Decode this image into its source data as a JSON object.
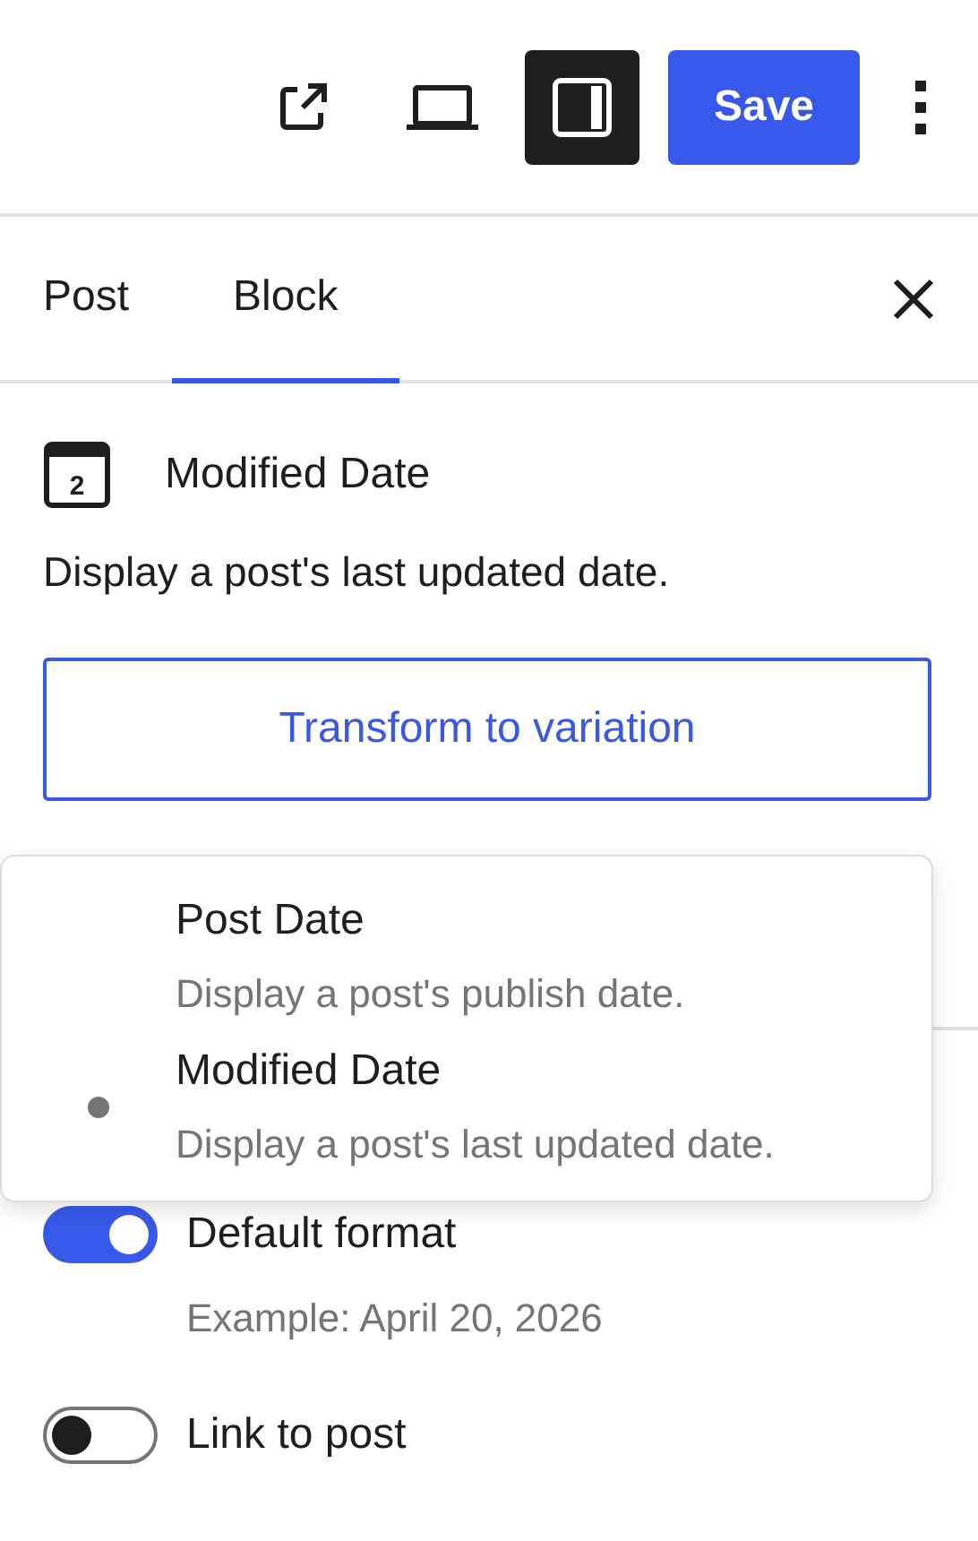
{
  "toolbar": {
    "save_label": "Save",
    "sidebar_toggle_on": true
  },
  "tabs": [
    {
      "label": "Post",
      "selected": false
    },
    {
      "label": "Block",
      "selected": true
    }
  ],
  "block": {
    "icon_label": "2",
    "title": "Modified Date",
    "description": "Display a post's last updated date.",
    "transform_button": "Transform to variation"
  },
  "variation_menu": [
    {
      "label": "Post Date",
      "description": "Display a post's publish date.",
      "selected": false
    },
    {
      "label": "Modified Date",
      "description": "Display a post's last updated date.",
      "selected": true
    }
  ],
  "settings": [
    {
      "label": "Default format",
      "on": true,
      "help": "Example: April 20, 2026"
    },
    {
      "label": "Link to post",
      "on": false
    }
  ]
}
